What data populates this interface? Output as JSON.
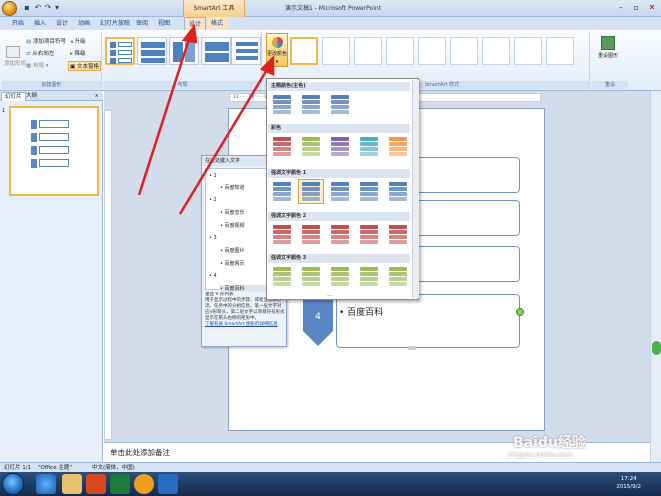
{
  "window": {
    "title": "演示文稿1 - Microsoft PowerPoint",
    "context_tab_group": "SmartArt 工具"
  },
  "tabs": [
    {
      "label": "开始"
    },
    {
      "label": "插入"
    },
    {
      "label": "设计"
    },
    {
      "label": "动画"
    },
    {
      "label": "幻灯片放映"
    },
    {
      "label": "审阅"
    },
    {
      "label": "视图"
    },
    {
      "label": "设计",
      "context": true,
      "active": true
    },
    {
      "label": "格式",
      "context": true
    }
  ],
  "ribbon": {
    "create_graphic": {
      "add_shape": "添加形状",
      "add_bullet": "添加项目符号",
      "right_to_left": "从右向左",
      "layout": "布局",
      "promote": "升级",
      "demote": "降级",
      "text_pane": "文本窗格",
      "group_label": "创建图形"
    },
    "layouts": {
      "group_label": "布局"
    },
    "styles": {
      "change_colors": "更改颜色",
      "group_label": "SmartArt 样式"
    },
    "reset": {
      "button": "重设图形",
      "group_label": "重设"
    }
  },
  "left_pane": {
    "tab_slides": "幻灯片",
    "tab_outline": "大纲",
    "close": "x"
  },
  "ruler": {
    "text": "· 12 · · · 10 · · · 8 · · · 6 · · · 4 · · · 2 · · · 0 · · · 2 · · · 4 · · · 6 · · · 8 · · · 10 · · · 12 ·"
  },
  "text_pane": {
    "title": "在此处键入文字",
    "items": [
      {
        "level": 1,
        "text": "1"
      },
      {
        "level": 2,
        "text": "百度知道"
      },
      {
        "level": 1,
        "text": "2"
      },
      {
        "level": 2,
        "text": "百度音乐"
      },
      {
        "level": 2,
        "text": "百度视频"
      },
      {
        "level": 1,
        "text": "3"
      },
      {
        "level": 2,
        "text": "百度图片"
      },
      {
        "level": 2,
        "text": "百度网页"
      },
      {
        "level": 1,
        "text": "4"
      },
      {
        "level": 2,
        "text": "百度百科"
      }
    ],
    "description_title": "垂直 V 形列表",
    "description": "用于显示过程中的步骤，或者显示工作流、任务中的分组信息。第一层文字对应V形箭头，第二层文字以项目符号形式显示在箭头右侧的矩形中。",
    "link": "了解有关 SmartArt 图形的详细信息"
  },
  "slide": {
    "visible_item_number": "4",
    "visible_item_text": "百度百科"
  },
  "color_dropdown": {
    "sections": [
      {
        "title": "主题颜色(主色)",
        "rows": 1,
        "colors": [
          "#5a7fb8",
          "#5a7fb8",
          "#5a7fb8"
        ]
      },
      {
        "title": "彩色",
        "rows": 1,
        "colors": [
          "#c0504d",
          "#9bbb59",
          "#8064a2",
          "#4bacc6",
          "#f79646"
        ]
      },
      {
        "title": "强调文字颜色 1",
        "rows": 1,
        "colors": [
          "#4f81bd",
          "#4f81bd",
          "#4f81bd",
          "#4f81bd",
          "#4f81bd"
        ]
      },
      {
        "title": "强调文字颜色 2",
        "rows": 1,
        "colors": [
          "#c0504d",
          "#c0504d",
          "#c0504d",
          "#c0504d",
          "#c0504d"
        ]
      },
      {
        "title": "强调文字颜色 3",
        "rows": 1,
        "colors": [
          "#9bbb59",
          "#9bbb59",
          "#9bbb59",
          "#9bbb59",
          "#9bbb59"
        ]
      }
    ],
    "more": "..."
  },
  "notes": {
    "placeholder": "单击此处添加备注"
  },
  "statusbar": {
    "slide": "幻灯片 1/1",
    "theme": "\"Office 主题\"",
    "lang": "中文(简体，中国)"
  },
  "taskbar": {
    "time": "17:24",
    "date": "2015/9/2"
  },
  "watermark": {
    "brand": "Baidu经验",
    "url": "jingyan.baidu.com"
  },
  "colors": {
    "accent": "#4f81bd",
    "arrow": "#e02020",
    "context": "#f3cf8f"
  }
}
